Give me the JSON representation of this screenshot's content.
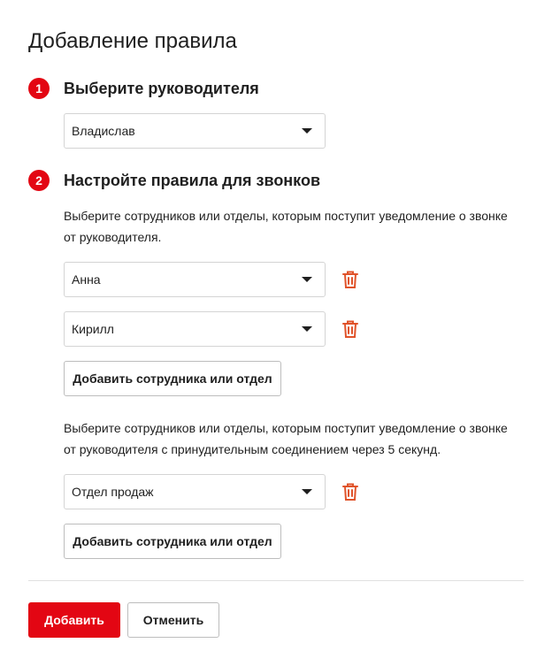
{
  "page": {
    "title": "Добавление правила"
  },
  "step1": {
    "number": "1",
    "title": "Выберите руководителя",
    "manager_select": {
      "value": "Владислав",
      "icon": "caret-down-icon"
    }
  },
  "step2": {
    "number": "2",
    "title": "Настройте правила для звонков",
    "group1": {
      "description": [
        "Выберите сотрудников или отделы, которым поступит уведомление о звонке",
        "от руководителя."
      ],
      "selects": [
        {
          "value": "Анна"
        },
        {
          "value": "Кирилл"
        }
      ],
      "add_button": "Добавить сотрудника или отдел"
    },
    "group2": {
      "description": [
        "Выберите сотрудников или отделы, которым поступит уведомление о звонке",
        "от руководителя с принудительным соединением через 5 секунд."
      ],
      "selects": [
        {
          "value": "Отдел продаж"
        }
      ],
      "add_button": "Добавить сотрудника или отдел"
    }
  },
  "footer": {
    "submit_label": "Добавить",
    "cancel_label": "Отменить"
  },
  "colors": {
    "accent": "#e30613",
    "trash": "#e0532a",
    "border": "#d4d4d4"
  },
  "icons": {
    "trash": "trash-icon",
    "caret": "caret-down-icon"
  }
}
